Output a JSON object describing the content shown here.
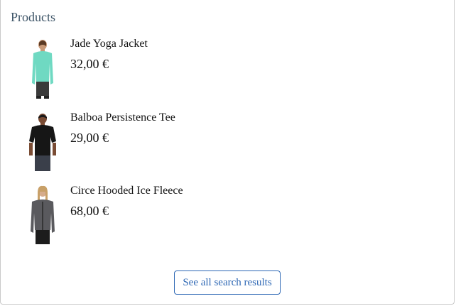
{
  "section_title": "Products",
  "products": [
    {
      "name": "Jade Yoga Jacket",
      "price": "32,00 €",
      "image": "product-jade-yoga-jacket",
      "shirt_color": "#6fd9c2",
      "pants_color": "#3a3a3a"
    },
    {
      "name": "Balboa Persistence Tee",
      "price": "29,00 €",
      "image": "product-balboa-persistence-tee",
      "shirt_color": "#161616",
      "pants_color": "#3a3f4a"
    },
    {
      "name": "Circe Hooded Ice Fleece",
      "price": "68,00 €",
      "image": "product-circe-hooded-ice-fleece",
      "shirt_color": "#5a5a5e",
      "pants_color": "#1c1c1c"
    }
  ],
  "see_all_label": "See all search results",
  "colors": {
    "accent": "#2d67b4",
    "title": "#3d5467"
  }
}
